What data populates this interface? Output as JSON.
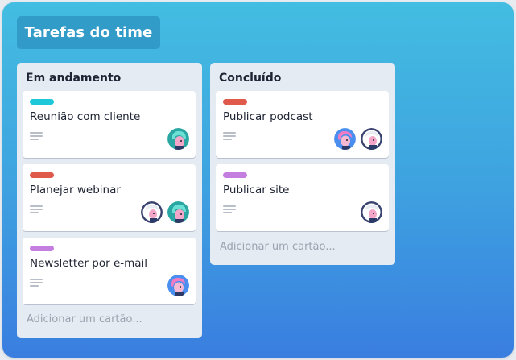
{
  "board": {
    "title": "Tarefas do time"
  },
  "lists": [
    {
      "title": "Em andamento",
      "add_card_label": "Adicionar um cartão...",
      "cards": [
        {
          "title": "Reunião com cliente",
          "label_color": "#1ec8d8",
          "has_description": true,
          "avatars": [
            "teal-hair-avatar"
          ]
        },
        {
          "title": "Planejar webinar",
          "label_color": "#e05a4c",
          "has_description": true,
          "avatars": [
            "white-hair-avatar",
            "teal-hair-avatar"
          ]
        },
        {
          "title": "Newsletter por e-mail",
          "label_color": "#c47ee0",
          "has_description": true,
          "avatars": [
            "pink-hair-avatar"
          ]
        }
      ]
    },
    {
      "title": "Concluído",
      "add_card_label": "Adicionar um cartão...",
      "cards": [
        {
          "title": "Publicar podcast",
          "label_color": "#e05a4c",
          "has_description": true,
          "avatars": [
            "pink-hair-avatar",
            "white-hair-avatar"
          ]
        },
        {
          "title": "Publicar site",
          "label_color": "#c47ee0",
          "has_description": true,
          "avatars": [
            "white-hair-avatar"
          ]
        }
      ]
    }
  ],
  "colors": {
    "board_gradient_top": "#43bde1",
    "board_gradient_bottom": "#3a7ee0",
    "list_background": "#e5ebf2",
    "card_background": "#ffffff"
  }
}
